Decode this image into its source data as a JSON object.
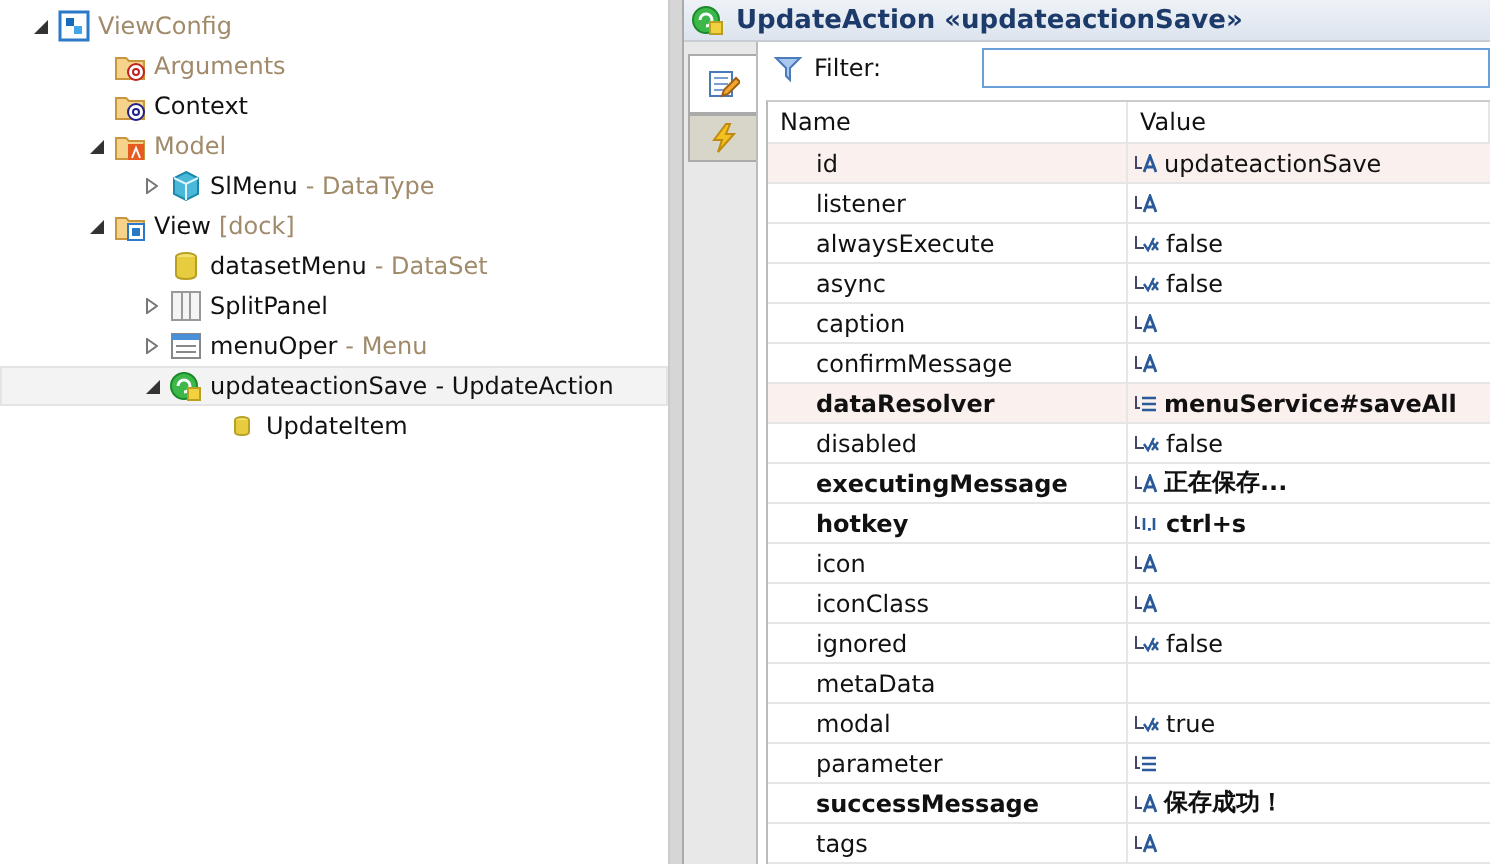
{
  "tree": [
    {
      "name": "ViewConfig",
      "kind": "config",
      "muted": true,
      "expanded": true,
      "selected": false,
      "children": [
        {
          "name": "Arguments",
          "kind": "folder-args",
          "muted": true,
          "selected": false
        },
        {
          "name": "Context",
          "kind": "folder-context",
          "muted": false,
          "selected": false
        },
        {
          "name": "Model",
          "kind": "folder-model",
          "muted": true,
          "expanded": true,
          "selected": false,
          "children": [
            {
              "name": "SlMenu",
              "suffix": "- DataType",
              "kind": "cube",
              "muted": false,
              "expanded": false,
              "selected": false
            }
          ]
        },
        {
          "name": "View",
          "suffix": "[dock]",
          "kind": "folder-view",
          "muted": false,
          "expanded": true,
          "selected": false,
          "children": [
            {
              "name": "datasetMenu",
              "suffix": "- DataSet",
              "kind": "dataset",
              "muted": false,
              "selected": false
            },
            {
              "name": "SplitPanel",
              "kind": "split",
              "muted": false,
              "expanded": false,
              "selected": false
            },
            {
              "name": "menuOper",
              "suffix": "- Menu",
              "kind": "menu",
              "muted": false,
              "expanded": false,
              "selected": false
            },
            {
              "name": "updateactionSave",
              "suffix": "- UpdateAction",
              "kind": "action",
              "muted": false,
              "expanded": true,
              "selected": true,
              "children": [
                {
                  "name": "UpdateItem",
                  "kind": "item",
                  "muted": false,
                  "selected": false
                }
              ]
            }
          ]
        }
      ]
    }
  ],
  "editor": {
    "title": "UpdateAction «updateactionSave»",
    "side_tabs": [
      {
        "kind": "properties",
        "selected": true
      },
      {
        "kind": "events",
        "selected": false
      }
    ],
    "filter": {
      "label": "Filter:"
    },
    "columns": [
      "Name",
      "Value"
    ],
    "rows": [
      {
        "name": "id",
        "kind": "text",
        "value": "updateactionSave",
        "modified": false,
        "highlighted": true
      },
      {
        "name": "listener",
        "kind": "text",
        "modified": false,
        "highlighted": false
      },
      {
        "name": "alwaysExecute",
        "kind": "bool",
        "value": "false",
        "modified": false,
        "highlighted": false
      },
      {
        "name": "async",
        "kind": "bool",
        "value": "false",
        "modified": false,
        "highlighted": false
      },
      {
        "name": "caption",
        "kind": "text",
        "modified": false,
        "highlighted": false
      },
      {
        "name": "confirmMessage",
        "kind": "text",
        "modified": false,
        "highlighted": false
      },
      {
        "name": "dataResolver",
        "kind": "list",
        "value": "menuService#saveAll",
        "modified": true,
        "highlighted": true
      },
      {
        "name": "disabled",
        "kind": "bool",
        "value": "false",
        "modified": false,
        "highlighted": false
      },
      {
        "name": "executingMessage",
        "kind": "text",
        "value": "正在保存...",
        "modified": true,
        "highlighted": false
      },
      {
        "name": "hotkey",
        "kind": "number",
        "value": "ctrl+s",
        "modified": true,
        "highlighted": false
      },
      {
        "name": "icon",
        "kind": "text",
        "modified": false,
        "highlighted": false
      },
      {
        "name": "iconClass",
        "kind": "text",
        "modified": false,
        "highlighted": false
      },
      {
        "name": "ignored",
        "kind": "bool",
        "value": "false",
        "modified": false,
        "highlighted": false
      },
      {
        "name": "metaData",
        "kind": "none",
        "modified": false,
        "highlighted": false
      },
      {
        "name": "modal",
        "kind": "bool",
        "value": "true",
        "modified": false,
        "highlighted": false
      },
      {
        "name": "parameter",
        "kind": "list",
        "modified": false,
        "highlighted": false
      },
      {
        "name": "successMessage",
        "kind": "text",
        "value": "保存成功！",
        "modified": true,
        "highlighted": false
      },
      {
        "name": "tags",
        "kind": "text",
        "modified": false,
        "highlighted": false
      }
    ]
  }
}
